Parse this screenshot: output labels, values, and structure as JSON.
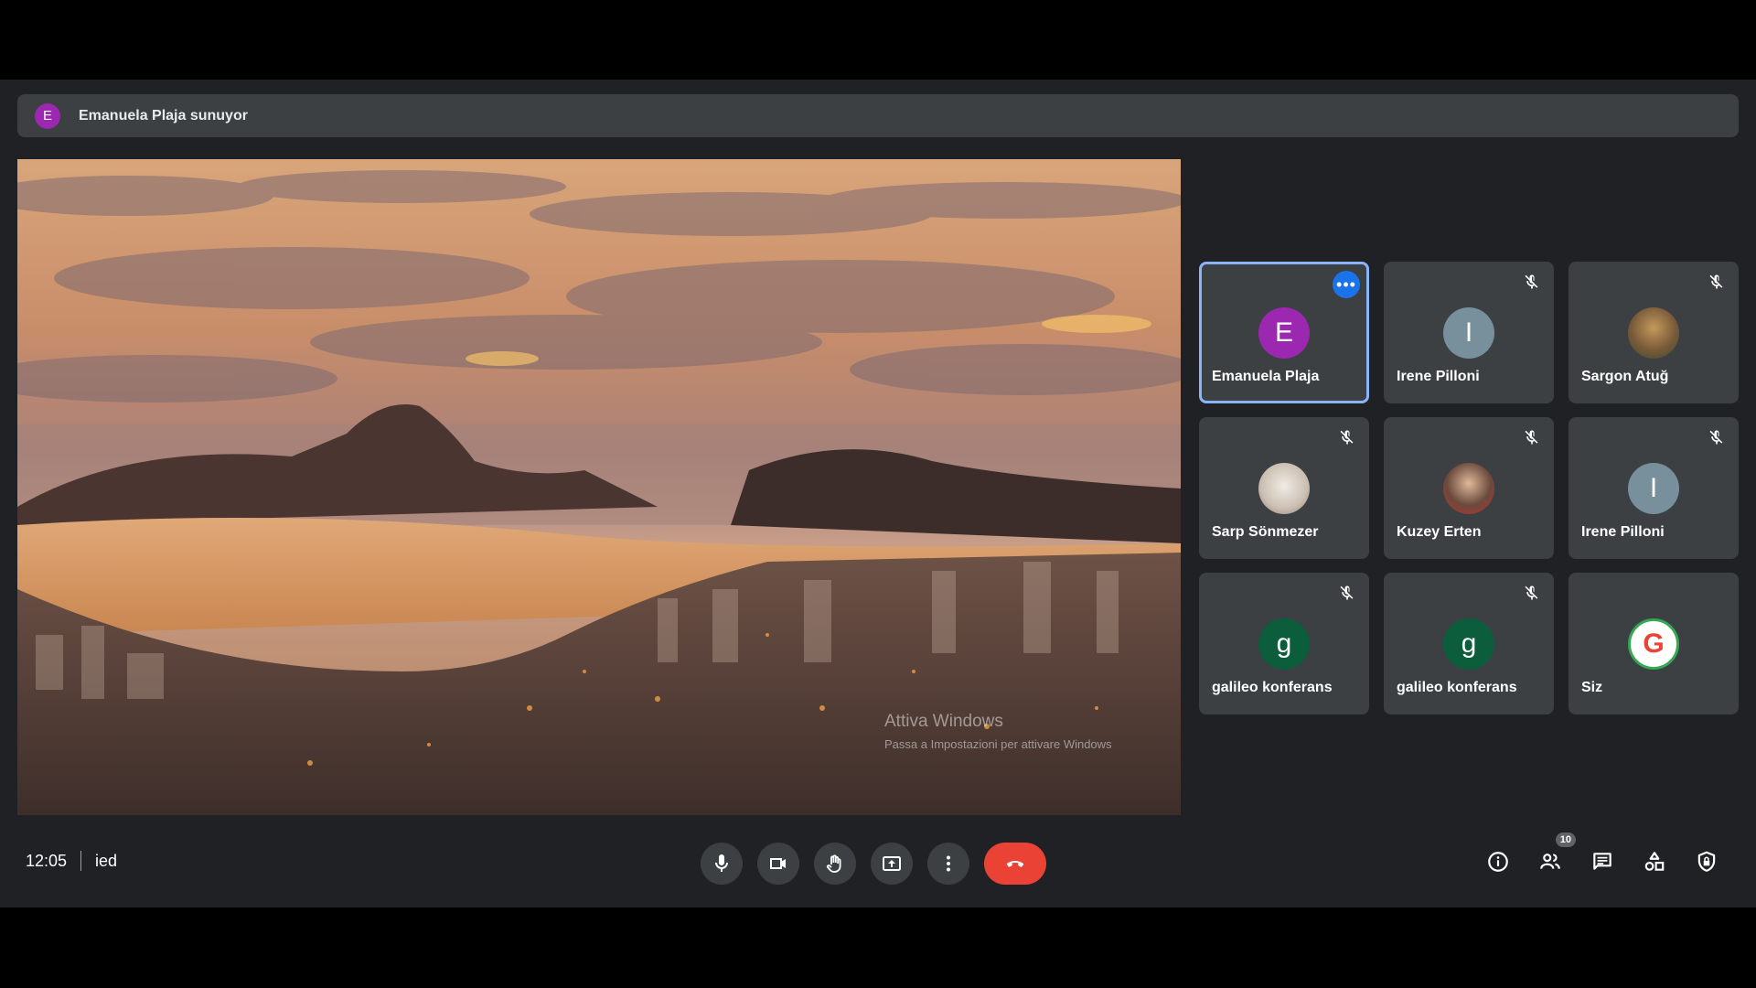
{
  "banner": {
    "badge": "E",
    "text": "Emanuela Plaja sunuyor"
  },
  "stage": {
    "watermark_title": "Attiva Windows",
    "watermark_sub": "Passa a Impostazioni per attivare Windows"
  },
  "participants": [
    {
      "name": "Emanuela Plaja",
      "initial": "E",
      "avatar_color": "#9c27b0",
      "muted": false,
      "active": true
    },
    {
      "name": "Irene Pilloni",
      "initial": "I",
      "avatar_color": "#78909c",
      "muted": true
    },
    {
      "name": "Sargon Atuğ",
      "initial": "",
      "avatar_color": "#7a5a3a",
      "muted": true
    },
    {
      "name": "Sarp Sönmezer",
      "initial": "",
      "avatar_color": "#d8d0c8",
      "muted": true
    },
    {
      "name": "Kuzey Erten",
      "initial": "",
      "avatar_color": "#5a4a3e",
      "muted": true
    },
    {
      "name": "Irene Pilloni",
      "initial": "I",
      "avatar_color": "#78909c",
      "muted": true
    },
    {
      "name": "galileo konferans",
      "initial": "g",
      "avatar_color": "#0b5d3b",
      "muted": true
    },
    {
      "name": "galileo konferans",
      "initial": "g",
      "avatar_color": "#0b5d3b",
      "muted": true
    },
    {
      "name": "Siz",
      "initial": "G",
      "avatar_color": "#ffffff",
      "muted": false
    }
  ],
  "footer": {
    "time": "12:05",
    "meeting_code": "ied",
    "people_count": "10"
  },
  "colors": {
    "hangup": "#ea4335",
    "accent": "#8ab4f8",
    "panel": "#3c4043"
  }
}
